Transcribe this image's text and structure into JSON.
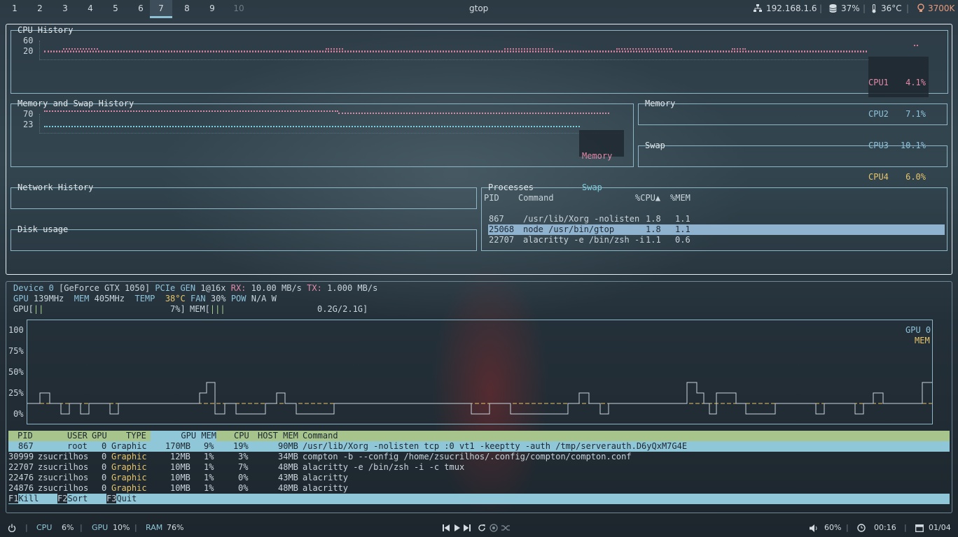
{
  "topbar": {
    "workspaces": [
      "1",
      "2",
      "3",
      "4",
      "5",
      "6",
      "7",
      "8",
      "9",
      "10"
    ],
    "active_workspace": "7",
    "title": "gtop",
    "ip": "192.168.1.6",
    "disk": "37%",
    "temp": "36°C",
    "color_temp": "3700K",
    "icons": {
      "network": "network-icon",
      "disk": "database-icon",
      "temp": "thermometer-icon",
      "bulb": "bulb-icon"
    },
    "accent": "#e89a7a"
  },
  "gtop": {
    "cpu_history": {
      "title": "CPU History",
      "y_labels": [
        "60",
        "20"
      ],
      "legend": [
        {
          "name": "CPU1",
          "value": "4.1%"
        },
        {
          "name": "CPU2",
          "value": "7.1%"
        },
        {
          "name": "CPU3",
          "value": "10.1%"
        },
        {
          "name": "CPU4",
          "value": "6.0%"
        }
      ]
    },
    "mem_history": {
      "title": "Memory and Swap History",
      "y_labels": [
        "70",
        "23"
      ],
      "legend": [
        "Memory",
        "Swap"
      ]
    },
    "memory_title": "Memory",
    "swap_title": "Swap",
    "network_title": "Network History",
    "disk_title": "Disk usage",
    "processes": {
      "title": "Processes",
      "headers": [
        "PID",
        "Command",
        "%CPU▲",
        "%MEM"
      ],
      "rows": [
        {
          "pid": "867",
          "cmd": "/usr/lib/Xorg -nolisten",
          "cpu": "1.8",
          "mem": "1.1"
        },
        {
          "pid": "25068",
          "cmd": "node /usr/bin/gtop",
          "cpu": "1.8",
          "mem": "1.1"
        },
        {
          "pid": "22707",
          "cmd": "alacritty -e /bin/zsh -i",
          "cpu": "1.1",
          "mem": "0.6"
        }
      ]
    }
  },
  "nvtop": {
    "line1": {
      "device": "Device 0",
      "name": "[GeForce GTX 1050]",
      "pcie": "PCIe",
      "gen_lbl": "GEN",
      "gen": "1@16x",
      "rx_lbl": "RX:",
      "rx": "10.00 MB/s",
      "tx_lbl": "TX:",
      "tx": "1.000 MB/s"
    },
    "line2": {
      "gpu_lbl": "GPU",
      "gpu": "139MHz",
      "mem_lbl": "MEM",
      "mem": "405MHz",
      "temp_lbl": "TEMP",
      "temp": "38°C",
      "fan_lbl": "FAN",
      "fan": "30%",
      "pow_lbl": "POW",
      "pow": "N/A W"
    },
    "line3": {
      "gpu_lbl": "GPU[",
      "gpu_bar": "||",
      "gpu_pct": "7%]",
      "mem_lbl": "MEM[",
      "mem_bar": "|||",
      "mem_val": "0.2G/2.1G]"
    },
    "graph_y": [
      "100",
      "75%",
      "50%",
      "25%",
      "0%"
    ],
    "graph_legend": [
      "GPU 0",
      "MEM"
    ],
    "table_headers": {
      "pid": "PID",
      "user": "USER",
      "gpu": "GPU",
      "type": "TYPE",
      "gpu_mem": "GPU MEM",
      "cpu": "CPU",
      "host_mem": "HOST MEM",
      "command": "Command"
    },
    "rows": [
      {
        "pid": "867",
        "user": "root",
        "gpu": "0",
        "type": "Graphic",
        "gmem": "170MB",
        "gpct": "9%",
        "cpu": "19%",
        "hmem": "90MB",
        "cmd": "/usr/lib/Xorg -nolisten tcp :0 vt1 -keeptty -auth /tmp/serverauth.D6yQxM7G4E"
      },
      {
        "pid": "30999",
        "user": "zsucrilhos",
        "gpu": "0",
        "type": "Graphic",
        "gmem": "12MB",
        "gpct": "1%",
        "cpu": "3%",
        "hmem": "34MB",
        "cmd": "compton -b --config /home/zsucrilhos/.config/compton/compton.conf"
      },
      {
        "pid": "22707",
        "user": "zsucrilhos",
        "gpu": "0",
        "type": "Graphic",
        "gmem": "10MB",
        "gpct": "1%",
        "cpu": "7%",
        "hmem": "48MB",
        "cmd": "alacritty -e /bin/zsh -i -c tmux"
      },
      {
        "pid": "22476",
        "user": "zsucrilhos",
        "gpu": "0",
        "type": "Graphic",
        "gmem": "10MB",
        "gpct": "1%",
        "cpu": "0%",
        "hmem": "43MB",
        "cmd": "alacritty"
      },
      {
        "pid": "24876",
        "user": "zsucrilhos",
        "gpu": "0",
        "type": "Graphic",
        "gmem": "10MB",
        "gpct": "1%",
        "cpu": "0%",
        "hmem": "48MB",
        "cmd": "alacritty"
      }
    ],
    "fkeys": [
      {
        "key": "F1",
        "label": "Kill"
      },
      {
        "key": "F2",
        "label": "Sort"
      },
      {
        "key": "F3",
        "label": "Quit"
      }
    ]
  },
  "bottombar": {
    "cpu_lbl": "CPU",
    "cpu": "6%",
    "gpu_lbl": "GPU",
    "gpu": "10%",
    "ram_lbl": "RAM",
    "ram": "76%",
    "volume": "60%",
    "time": "00:16",
    "date": "01/04"
  }
}
